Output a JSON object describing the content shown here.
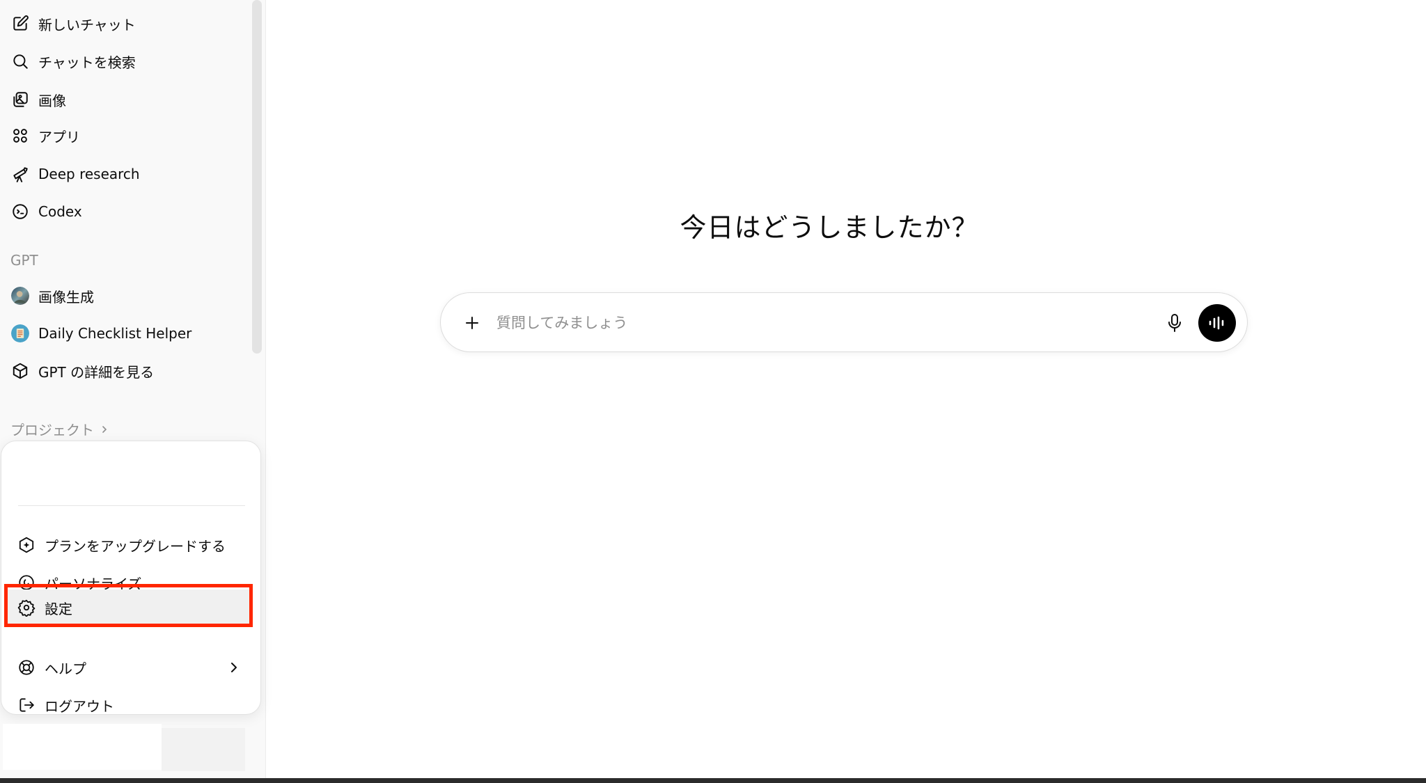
{
  "sidebar": {
    "nav": [
      {
        "label": "新しいチャット",
        "icon": "new-chat-icon"
      },
      {
        "label": "チャットを検索",
        "icon": "search-icon"
      },
      {
        "label": "画像",
        "icon": "images-icon"
      },
      {
        "label": "アプリ",
        "icon": "apps-icon"
      },
      {
        "label": "Deep research",
        "icon": "telescope-icon"
      },
      {
        "label": "Codex",
        "icon": "codex-icon"
      }
    ],
    "gpt_section_label": "GPT",
    "gpts": [
      {
        "label": "画像生成",
        "icon": "image-gen-avatar"
      },
      {
        "label": "Daily Checklist Helper",
        "icon": "checklist-avatar"
      },
      {
        "label": "GPT の詳細を見る",
        "icon": "cube-icon"
      }
    ],
    "projects_label": "プロジェクト"
  },
  "menu": {
    "items": [
      {
        "label": "プランをアップグレードする",
        "icon": "upgrade-icon"
      },
      {
        "label": "パーソナライズ",
        "icon": "personalize-icon"
      },
      {
        "label": "設定",
        "icon": "gear-icon"
      },
      {
        "label": "ヘルプ",
        "icon": "lifebuoy-icon"
      },
      {
        "label": "ログアウト",
        "icon": "logout-icon"
      }
    ],
    "highlight_color": "#ff2600"
  },
  "main": {
    "greeting": "今日はどうしましたか？",
    "composer": {
      "placeholder": "質問してみましょう"
    }
  }
}
